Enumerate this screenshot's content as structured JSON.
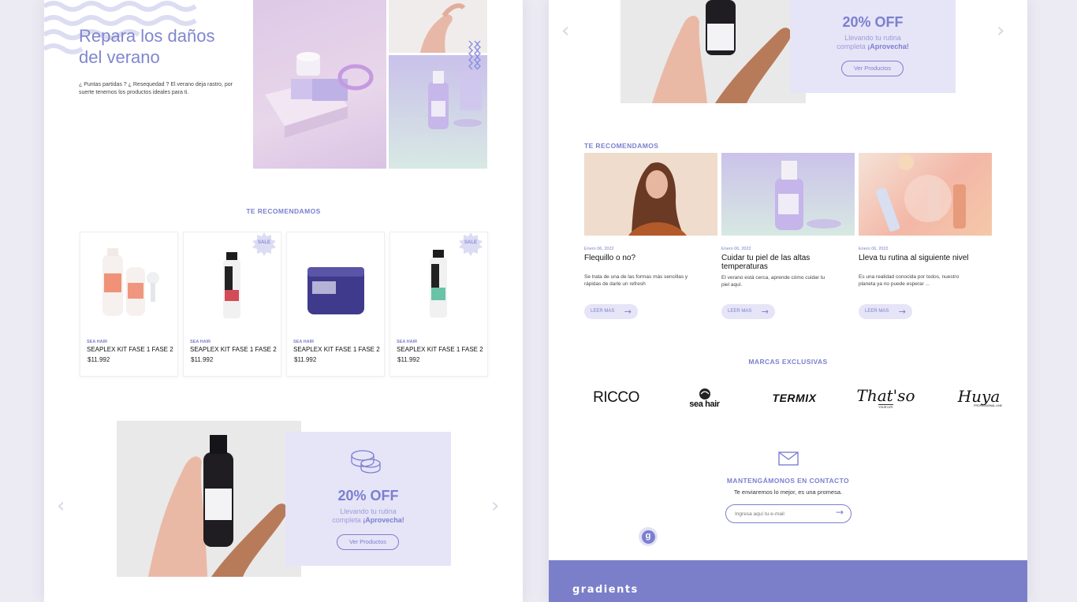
{
  "left": {
    "hero": {
      "title_line1": "Repara los daños",
      "title_line2": "del verano",
      "text": "¿ Puntas partidas ? ¿ Resequedad ? El verano deja rastro, por suerte tenemos los productos ideales para ti."
    },
    "recommend_title": "TE RECOMENDAMOS",
    "products": [
      {
        "brand": "SEA HAIR",
        "name": "SEAPLEX KIT FASE 1 FASE 2",
        "price": "$11.992",
        "sale": false
      },
      {
        "brand": "SEA HAIR",
        "name": "SEAPLEX KIT FASE 1 FASE 2",
        "price": "$11.992",
        "sale": true
      },
      {
        "brand": "SEA HAIR",
        "name": "SEAPLEX KIT FASE 1 FASE 2",
        "price": "$11.992",
        "sale": false
      },
      {
        "brand": "SEA HAIR",
        "name": "SEAPLEX KIT FASE 1 FASE 2",
        "price": "$11.992",
        "sale": true
      }
    ],
    "sale_label": "SALE",
    "promo": {
      "off": "20% OFF",
      "sub_line1": "Llevando tu rutina",
      "sub_line2_plain": "completa ",
      "sub_line2_bold": "¡Aprovecha!",
      "button": "Ver Productos"
    }
  },
  "right": {
    "promo": {
      "off": "20% OFF",
      "sub_line1": "Llevando tu rutina",
      "sub_line2_plain": "completa ",
      "sub_line2_bold": "¡Aprovecha!",
      "button": "Ver Productos"
    },
    "recommend_title": "TE RECOMENDAMOS",
    "posts": [
      {
        "date": "Enero 06, 2022",
        "title": "Flequillo o no?",
        "text": "Se trata de una de las formas más sencillas y rápidas de darle un refresh",
        "button": "LEER MAS"
      },
      {
        "date": "Enero 06, 2022",
        "title": "Cuidar tu piel de las altas temperaturas",
        "text": "El verano está cerca, aprende cómo cuidar tu piel aquí.",
        "button": "LEER MAS"
      },
      {
        "date": "Enero 06, 2022",
        "title": "Lleva tu rutina al siguiente nivel",
        "text": "Es una realidad conocida por todos, nuestro planeta ya no puede esperar ...",
        "button": "LEER MAS"
      }
    ],
    "brands_title": "MARCAS EXCLUSIVAS",
    "brands": [
      "RICCO",
      "sea hair",
      "TERMIX",
      "That'so",
      "Huya"
    ],
    "brand_sublabels": {
      "thatso": "YOUR LIFE",
      "huya": "PROFESSIONAL LINE"
    },
    "contact": {
      "title": "MANTENGÁMONOS EN CONTACTO",
      "subtitle": "Te enviaremos lo mejor, es una promesa.",
      "placeholder": "Ingresa aquí tu e-mail"
    },
    "badge_letter": "g",
    "footer_brand": "gradients"
  },
  "colors": {
    "accent": "#7b7fcf",
    "lavender": "#e6e4f7",
    "footer": "#7b7fc9"
  }
}
